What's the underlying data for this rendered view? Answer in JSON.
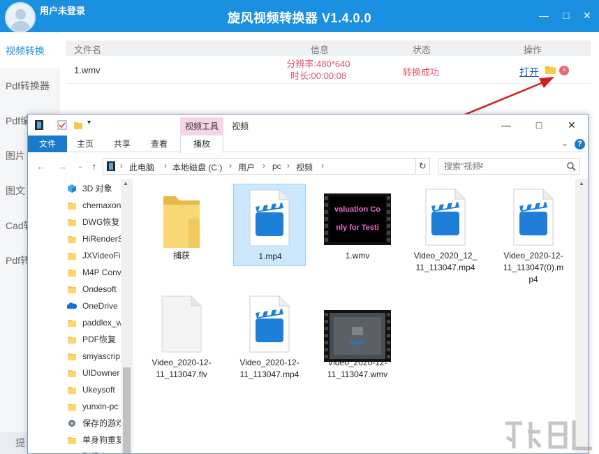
{
  "app": {
    "user_label": "用户未登录",
    "title": "旋风视频转换器 V1.4.0.0",
    "colors": {
      "header": "#1b8fe0",
      "status": "#e0506a",
      "link": "#1b5ec2"
    },
    "window_controls": {
      "minimize": "—",
      "maximize": "□",
      "close": "✕"
    },
    "sidebar": [
      {
        "label": "视频转换",
        "active": true
      },
      {
        "label": "Pdf转换器"
      },
      {
        "label": "Pdf编"
      },
      {
        "label": "图片"
      },
      {
        "label": "图文"
      },
      {
        "label": "Cad转"
      },
      {
        "label": "Pdf转"
      }
    ],
    "sidebar_bottom": "提",
    "table": {
      "headers": {
        "name": "文件名",
        "info": "信息",
        "status": "状态",
        "ops": "操作"
      },
      "row": {
        "name": "1.wmv",
        "resolution": "分辨率:480*640",
        "duration": "时长:00:00:08",
        "status": "转换成功",
        "open": "打开",
        "close_glyph": "×"
      }
    }
  },
  "explorer": {
    "context_tab": "视频工具",
    "title": "视频",
    "window_controls": {
      "minimize": "—",
      "maximize": "□",
      "close": "✕"
    },
    "ribbon_tabs": {
      "file": "文件",
      "home": "主页",
      "share": "共享",
      "view": "查看",
      "play": "播放"
    },
    "ribbon_collapse": "⌄",
    "help": "?",
    "nav_buttons": {
      "back": "←",
      "forward": "→",
      "recent": "⌄",
      "up": "↑"
    },
    "breadcrumb": [
      "此电脑",
      "本地磁盘 (C:)",
      "用户",
      "pc",
      "视频"
    ],
    "crumb_sep": "›",
    "address_dropdown": "⌄",
    "refresh": "↻",
    "search_placeholder": "搜索\"视频\"",
    "nav_tree": [
      {
        "label": "3D 对象",
        "icon": "3d-objects-icon"
      },
      {
        "label": "chemaxon",
        "icon": "folder-icon"
      },
      {
        "label": "DWG恢复",
        "icon": "folder-icon"
      },
      {
        "label": "HiRenderS",
        "icon": "folder-icon"
      },
      {
        "label": "JXVideoFi",
        "icon": "folder-icon"
      },
      {
        "label": "M4P Conv",
        "icon": "folder-icon"
      },
      {
        "label": "Ondesoft",
        "icon": "folder-icon"
      },
      {
        "label": "OneDrive",
        "icon": "onedrive-icon"
      },
      {
        "label": "paddlex_w",
        "icon": "folder-icon"
      },
      {
        "label": "PDF恢复",
        "icon": "folder-icon"
      },
      {
        "label": "smyascrip",
        "icon": "folder-icon"
      },
      {
        "label": "UIDowner",
        "icon": "folder-icon"
      },
      {
        "label": "Ukeysoft",
        "icon": "folder-icon"
      },
      {
        "label": "yunxin-pc",
        "icon": "folder-icon"
      },
      {
        "label": "保存的游戏",
        "icon": "saved-games-icon"
      },
      {
        "label": "单身狗重复",
        "icon": "folder-icon"
      },
      {
        "label": "联系人",
        "icon": "contacts-icon"
      }
    ],
    "files": [
      {
        "name": "捕获",
        "kind": "folder"
      },
      {
        "name": "1.mp4",
        "kind": "video",
        "selected": true
      },
      {
        "name": "1.wmv",
        "kind": "eval-thumb",
        "thumb_text_1": "valuation Co",
        "thumb_text_2": "nly for Testi"
      },
      {
        "name": "Video_2020_12_11_113047.mp4",
        "kind": "video",
        "display": "Video_2020_12_\n11_113047.mp4"
      },
      {
        "name": "Video_2020-12-11_113047(0).mp4",
        "kind": "video",
        "display": "Video_2020-12-\n11_113047(0).m\np4"
      },
      {
        "name": "Video_2020-12-11_113047.flv",
        "kind": "blank",
        "display": "Video_2020-12-\n11_113047.flv"
      },
      {
        "name": "Video_2020-12-11_113047.mp4",
        "kind": "video",
        "display": "Video_2020-12-\n11_113047.mp4"
      },
      {
        "name": "Video_2020-12-11_113047.wmv",
        "kind": "screen-thumb",
        "display": "Video_2020-12-\n11_113047.wmv"
      }
    ]
  }
}
